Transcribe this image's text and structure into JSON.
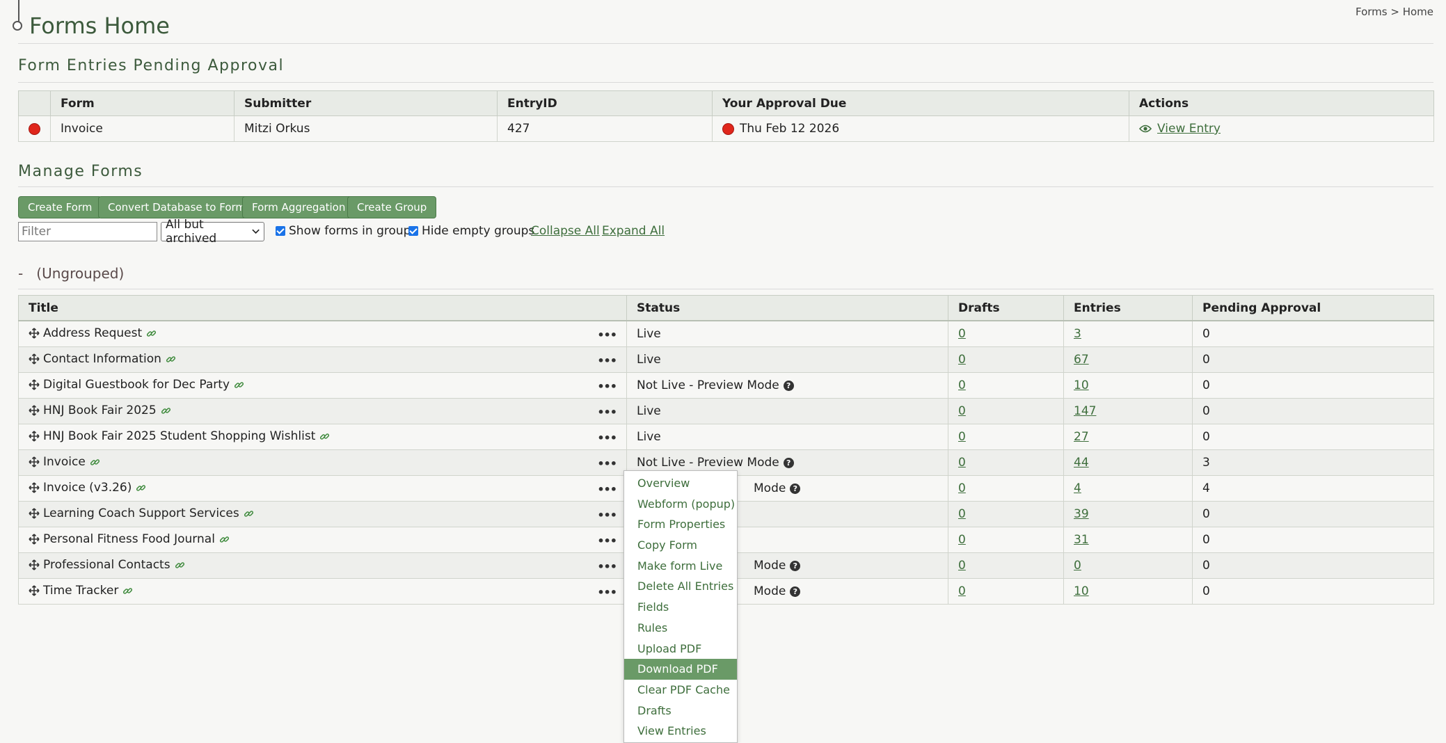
{
  "breadcrumb": "Forms > Home",
  "page_title": "Forms Home",
  "pending": {
    "title": "Form Entries Pending Approval",
    "columns": [
      "",
      "Form",
      "Submitter",
      "EntryID",
      "Your Approval Due",
      "Actions"
    ],
    "rows": [
      {
        "form": "Invoice",
        "submitter": "Mitzi Orkus",
        "entry_id": "427",
        "due": "Thu Feb 12 2026",
        "action": "View Entry"
      }
    ]
  },
  "manage": {
    "title": "Manage Forms",
    "buttons": {
      "create_form": "Create Form",
      "convert_db": "Convert Database to Form",
      "aggregation": "Form Aggregation",
      "create_group": "Create Group"
    },
    "filter_placeholder": "Filter",
    "archive_select": "All but archived",
    "show_in_groups": "Show forms in groups",
    "hide_empty": "Hide empty groups",
    "collapse_all": "Collapse All",
    "expand_all": "Expand All"
  },
  "group": {
    "toggle": "-",
    "name": "(Ungrouped)"
  },
  "forms": {
    "columns": [
      "Title",
      "Status",
      "Drafts",
      "Entries",
      "Pending Approval"
    ],
    "rows": [
      {
        "title": "Address Request",
        "status": "Live",
        "drafts": "0",
        "entries": "3",
        "pending": "0"
      },
      {
        "title": "Contact Information",
        "status": "Live",
        "drafts": "0",
        "entries": "67",
        "pending": "0"
      },
      {
        "title": "Digital Guestbook for Dec Party",
        "status": "Not Live - Preview Mode",
        "drafts": "0",
        "entries": "10",
        "pending": "0"
      },
      {
        "title": "HNJ Book Fair 2025",
        "status": "Live",
        "drafts": "0",
        "entries": "147",
        "pending": "0"
      },
      {
        "title": "HNJ Book Fair 2025 Student Shopping Wishlist",
        "status": "Live",
        "drafts": "0",
        "entries": "27",
        "pending": "0"
      },
      {
        "title": "Invoice",
        "status": "Not Live - Preview Mode",
        "drafts": "0",
        "entries": "44",
        "pending": "3"
      },
      {
        "title": "Invoice (v3.26)",
        "status": "Mode",
        "drafts": "0",
        "entries": "4",
        "pending": "4"
      },
      {
        "title": "Learning Coach Support Services",
        "status": "",
        "drafts": "0",
        "entries": "39",
        "pending": "0"
      },
      {
        "title": "Personal Fitness Food Journal",
        "status": "",
        "drafts": "0",
        "entries": "31",
        "pending": "0"
      },
      {
        "title": "Professional Contacts",
        "status": "Mode",
        "drafts": "0",
        "entries": "0",
        "pending": "0"
      },
      {
        "title": "Time Tracker",
        "status": "Mode",
        "drafts": "0",
        "entries": "10",
        "pending": "0"
      }
    ]
  },
  "context_menu": {
    "items": [
      "Overview",
      "Webform (popup)",
      "Form Properties",
      "Copy Form",
      "Make form Live",
      "Delete All Entries",
      "Fields",
      "Rules",
      "Upload PDF",
      "Download PDF",
      "Clear PDF Cache",
      "Drafts",
      "View Entries"
    ],
    "highlighted": "Download PDF"
  },
  "icons": {
    "status_dot": "red-dot-icon",
    "view": "eye-icon",
    "row_handle": "move-icon",
    "row_link": "link-icon",
    "row_menu": "ellipsis-icon",
    "status_help": "help-icon"
  },
  "colors": {
    "accent": "#6a9a67",
    "link": "#3e6e3c",
    "alert": "#e0261b"
  }
}
